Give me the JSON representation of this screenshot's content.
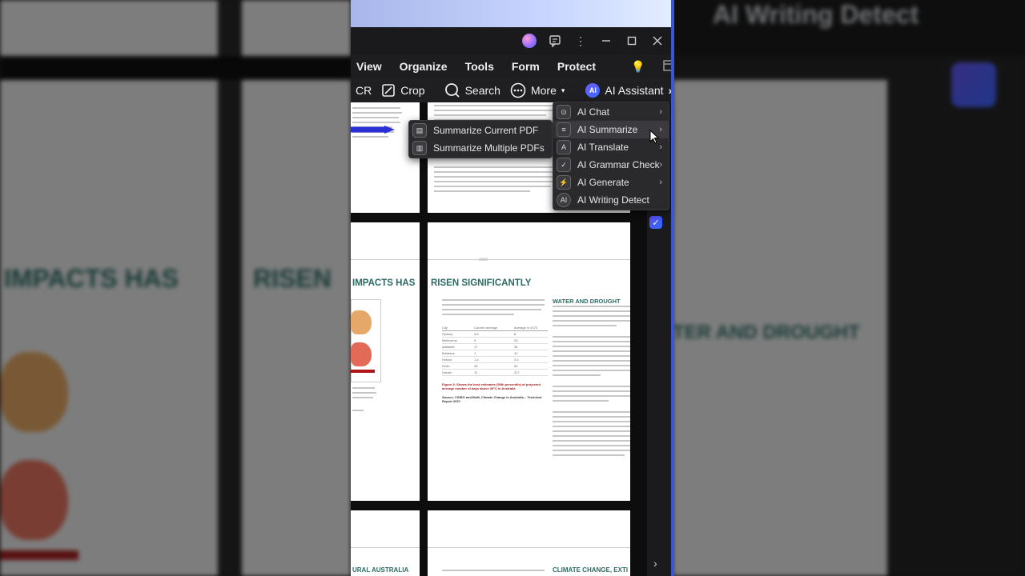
{
  "background": {
    "left_heading": "IMPACTS HAS",
    "left_heading2": "RISEN",
    "right_heading": "TER AND DROUGHT",
    "right_title": "AI Writing Detect"
  },
  "window": {
    "controls": [
      "minimize",
      "maximize",
      "close"
    ]
  },
  "menubar": {
    "items": [
      "View",
      "Organize",
      "Tools",
      "Form",
      "Protect"
    ]
  },
  "toolbar": {
    "ocr_label": "CR",
    "crop_label": "Crop",
    "search_label": "Search",
    "more_label": "More",
    "ai_badge": "AI",
    "ai_assistant_label": "AI Assistant"
  },
  "ai_menu": {
    "items": [
      {
        "label": "AI Chat",
        "has_submenu": true
      },
      {
        "label": "AI Summarize",
        "has_submenu": true
      },
      {
        "label": "AI Translate",
        "has_submenu": true
      },
      {
        "label": "AI Grammar Check",
        "has_submenu": true
      },
      {
        "label": "AI Generate",
        "has_submenu": true
      },
      {
        "label": "AI Writing Detect",
        "has_submenu": false
      }
    ],
    "selected": "AI Summarize"
  },
  "summarize_submenu": {
    "items": [
      "Summarize Current PDF",
      "Summarize Multiple PDFs"
    ]
  },
  "document": {
    "page2_left_heading": "IMPACTS HAS",
    "page2_right_heading": "RISEN SIGNIFICANTLY",
    "section_heading": "WATER AND DROUGHT",
    "page3_left_heading": "URAL AUSTRALIA",
    "page3_right_heading": "CLIMATE CHANGE, EXTI",
    "page_number": "2030",
    "figure_caption": "Figure 3: Shows the best estimates (50th percentile) of projected average number of days above 35°C in Australia",
    "figure_source": "Source: CSIRO and BoM, Climate Change in Australia – Technical Report 2007",
    "table_headers": [
      "City",
      "Current average",
      "Average in 2070"
    ],
    "table_rows": [
      [
        "Sydney",
        "3.5",
        "8"
      ],
      [
        "Melbourne",
        "9",
        "20"
      ],
      [
        "Adelaide",
        "17",
        "36"
      ],
      [
        "Brisbane",
        "1",
        "12"
      ],
      [
        "Hobart",
        "1.4",
        "2.4"
      ],
      [
        "Perth",
        "28",
        "54"
      ],
      [
        "Darwin",
        "11",
        "227"
      ]
    ]
  },
  "colors": {
    "accent": "#3a55d8",
    "heading_green": "#2b6b63",
    "arrow": "#2a2fd6"
  }
}
